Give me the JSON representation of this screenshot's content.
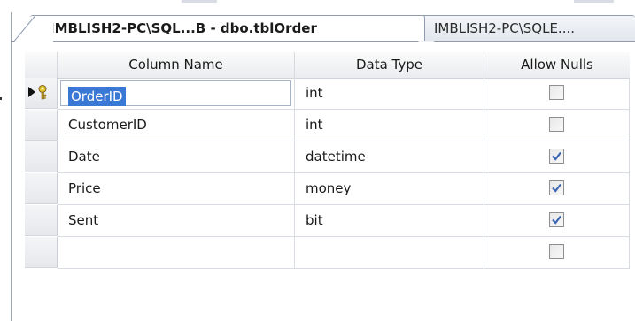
{
  "tabs": {
    "active": "IMBLISH2-PC\\SQL...B - dbo.tblOrder",
    "inactive": "IMBLISH2-PC\\SQLE...."
  },
  "grid": {
    "headers": {
      "name": "Column Name",
      "type": "Data Type",
      "nulls": "Allow Nulls"
    },
    "rows": [
      {
        "name": "OrderID",
        "type": "int",
        "allow_nulls": false,
        "primary_key": true,
        "current": true
      },
      {
        "name": "CustomerID",
        "type": "int",
        "allow_nulls": false
      },
      {
        "name": "Date",
        "type": "datetime",
        "allow_nulls": true
      },
      {
        "name": "Price",
        "type": "money",
        "allow_nulls": true
      },
      {
        "name": "Sent",
        "type": "bit",
        "allow_nulls": true
      },
      {
        "name": "",
        "type": "",
        "allow_nulls": false
      }
    ]
  },
  "icons": {
    "row_pointer": "current-row-arrow-icon",
    "key": "primary-key-icon",
    "checkbox": "checkbox-icon"
  },
  "colors": {
    "selection": "#3a78d6",
    "check": "#3b66b0",
    "tab_border": "#8e9bb0"
  }
}
